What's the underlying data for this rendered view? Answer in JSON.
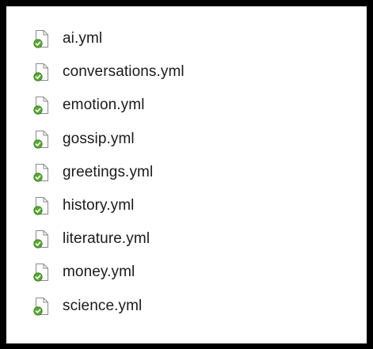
{
  "file_list": {
    "icon": "script-file-with-green-check-icon",
    "icon_colors": {
      "page": "#ffffff",
      "page_border": "#8a8a8a",
      "badge": "#5aa832",
      "badge_dark": "#2f7d1a",
      "check": "#ffffff"
    },
    "items": [
      {
        "name": "ai.yml"
      },
      {
        "name": "conversations.yml"
      },
      {
        "name": "emotion.yml"
      },
      {
        "name": "gossip.yml"
      },
      {
        "name": "greetings.yml"
      },
      {
        "name": "history.yml"
      },
      {
        "name": "literature.yml"
      },
      {
        "name": "money.yml"
      },
      {
        "name": "science.yml"
      }
    ]
  }
}
